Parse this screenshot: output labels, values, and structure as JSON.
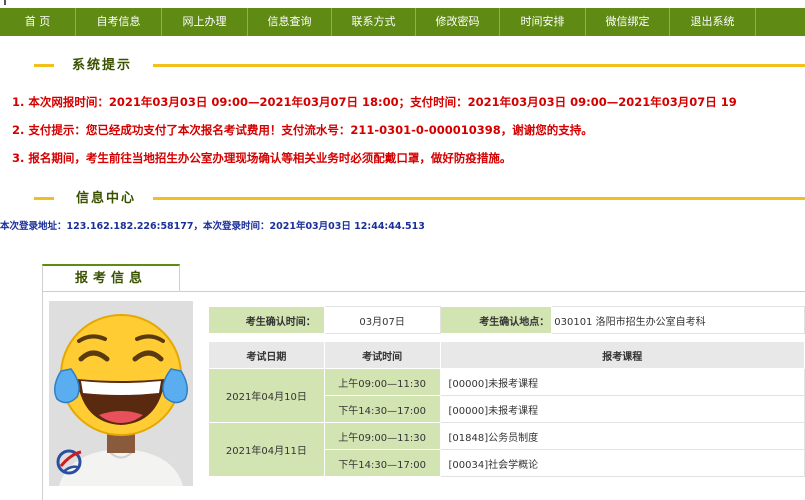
{
  "nav": {
    "items": [
      "首 页",
      "自考信息",
      "网上办理",
      "信息查询",
      "联系方式",
      "修改密码",
      "时间安排",
      "微信绑定",
      "退出系统"
    ]
  },
  "system_notice": {
    "title": "系统提示",
    "items": [
      "1. 本次网报时间：2021年03月03日 09:00—2021年03月07日 18:00；支付时间：2021年03月03日 09:00—2021年03月07日 19",
      "2. 支付提示：您已经成功支付了本次报名考试费用！支付流水号：211-0301-0-000010398，谢谢您的支持。",
      "3. 报名期间，考生前往当地招生办公室办理现场确认等相关业务时必须配戴口罩，做好防疫措施。"
    ]
  },
  "info_center": {
    "title": "信息中心",
    "login_info": "本次登录地址：123.162.182.226:58177，本次登录时间：2021年03月03日 12:44:44.513"
  },
  "registration": {
    "tab_label": "报考信息",
    "confirm_time_label": "考生确认时间：",
    "confirm_time_value": "03月07日",
    "confirm_place_label": "考生确认地点：",
    "confirm_place_value": "030101   洛阳市招生办公室自考科",
    "headers": [
      "考试日期",
      "考试时间",
      "报考课程"
    ],
    "rows": [
      {
        "date": "2021年04月10日",
        "sessions": [
          {
            "time": "上午09:00—11:30",
            "course": "[00000]未报考课程"
          },
          {
            "time": "下午14:30—17:00",
            "course": "[00000]未报考课程"
          }
        ]
      },
      {
        "date": "2021年04月11日",
        "sessions": [
          {
            "time": "上午09:00—11:30",
            "course": "[01848]公务员制度"
          },
          {
            "time": "下午14:30—17:00",
            "course": "[00034]社会学概论"
          }
        ]
      }
    ]
  },
  "colors": {
    "nav": "#5f8a13",
    "accent": "#f2c01b",
    "notice": "#d40000",
    "link": "#1a2f9a"
  }
}
